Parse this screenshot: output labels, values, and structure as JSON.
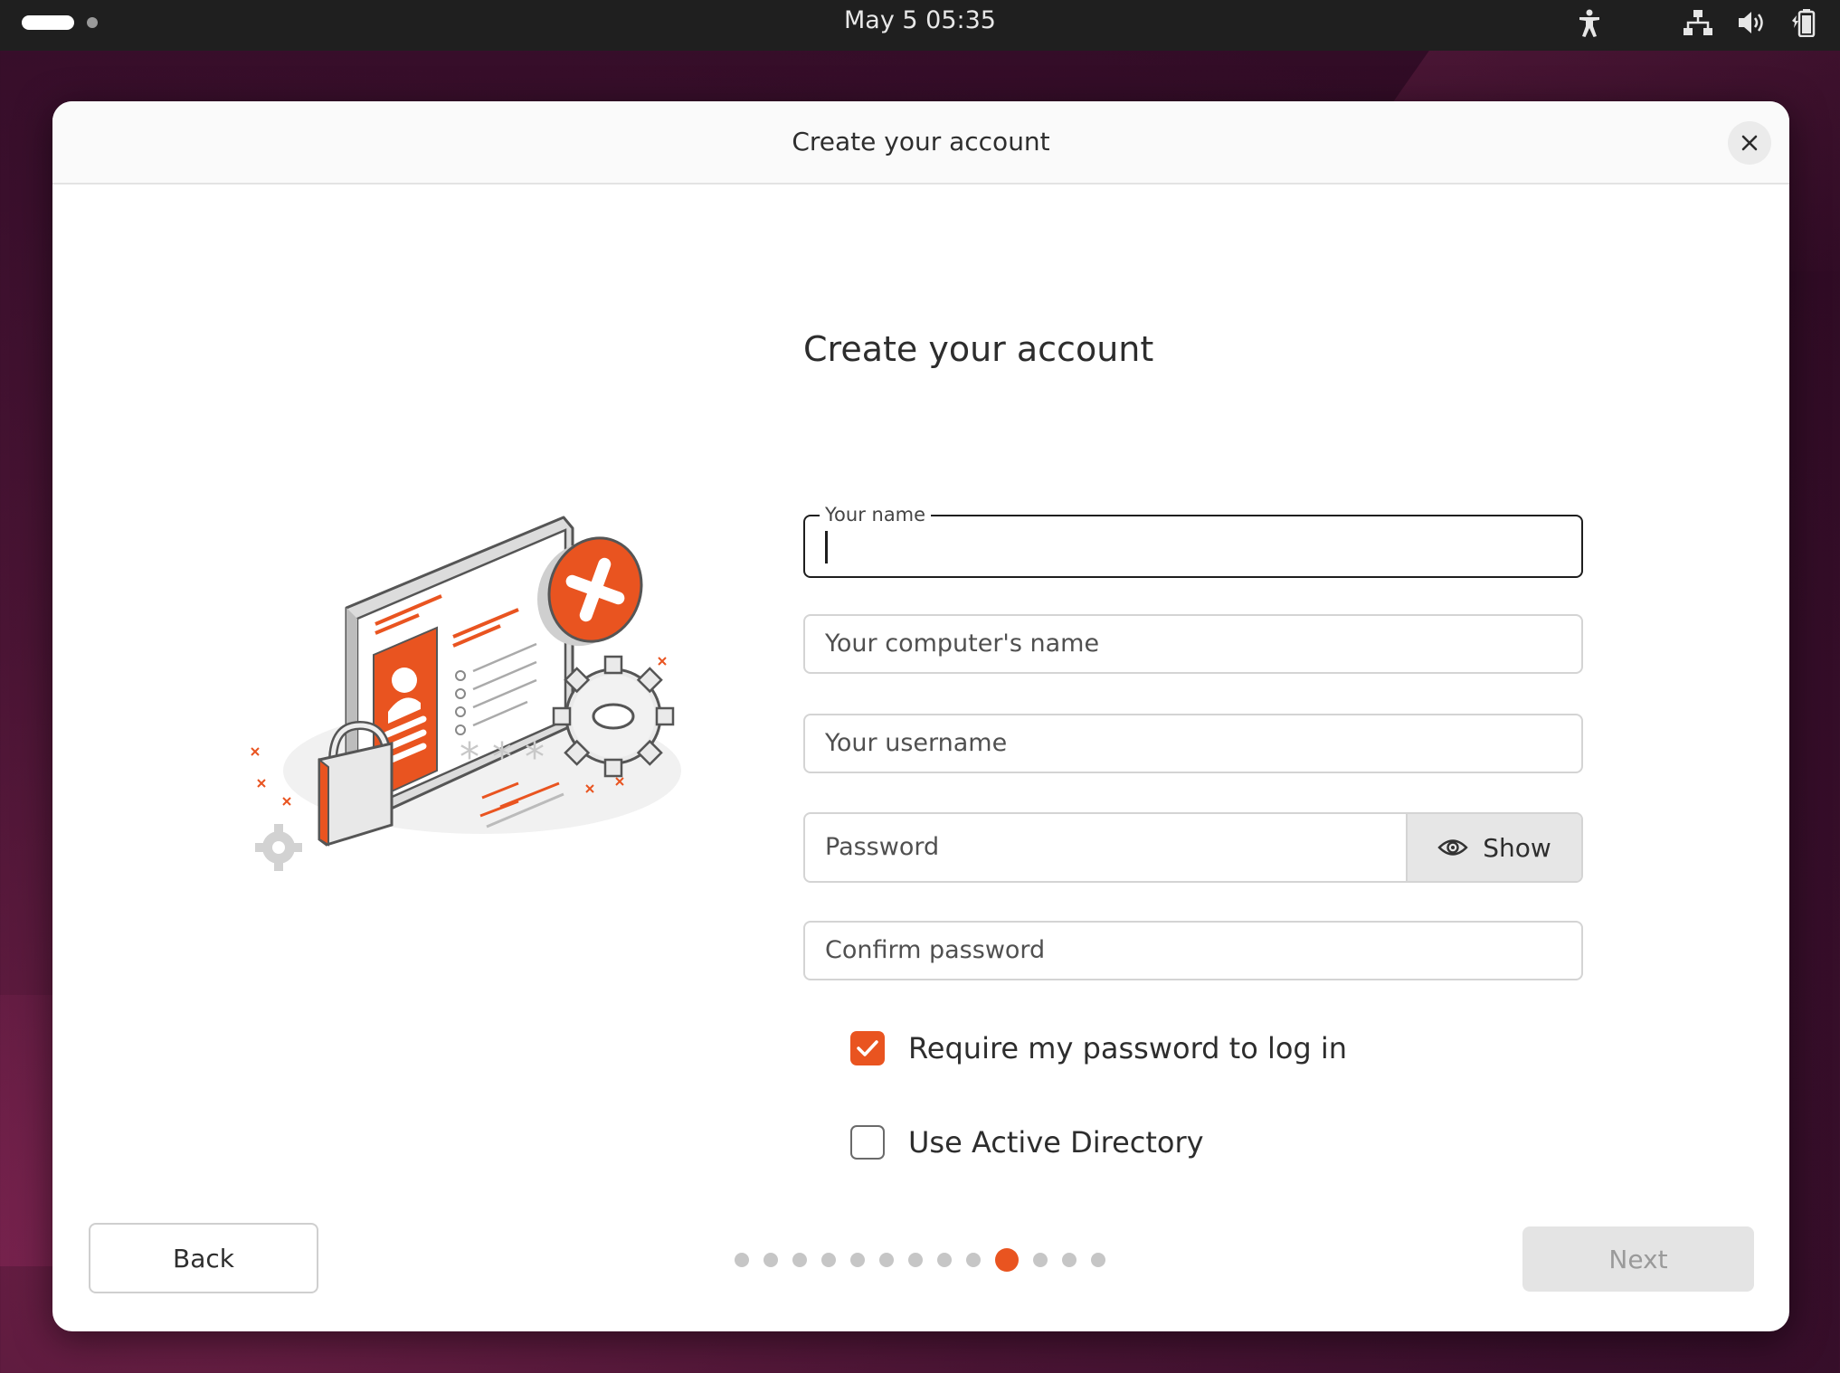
{
  "topbar": {
    "clock": "May 5  05:35",
    "tray_icons": [
      "accessibility-icon",
      "network-icon",
      "volume-icon",
      "battery-icon"
    ]
  },
  "window": {
    "title": "Create your account",
    "close_icon": "close-icon"
  },
  "form": {
    "heading": "Create your account",
    "name_label": "Your name",
    "name_value": "",
    "computer_name_placeholder": "Your computer's name",
    "username_placeholder": "Your username",
    "password_placeholder": "Password",
    "show_label": "Show",
    "confirm_placeholder": "Confirm password",
    "require_password_label": "Require my password to log in",
    "require_password_checked": true,
    "active_directory_label": "Use Active Directory",
    "active_directory_checked": false
  },
  "footer": {
    "back_label": "Back",
    "next_label": "Next",
    "pager_total": 13,
    "pager_current": 10
  },
  "colors": {
    "accent": "#e95420",
    "topbar": "#1f1f1f"
  }
}
